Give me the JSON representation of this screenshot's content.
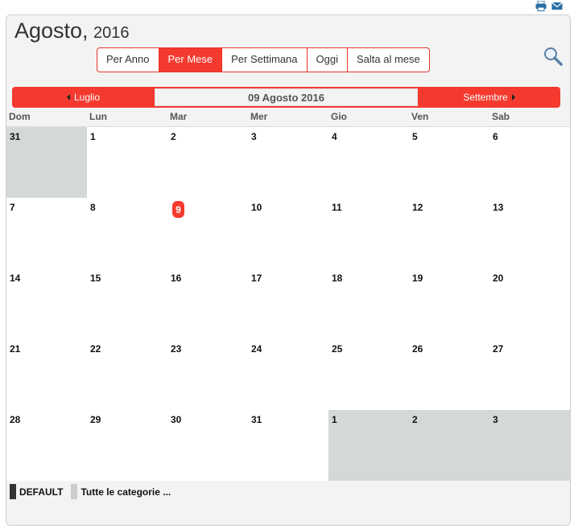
{
  "header": {
    "month": "Agosto,",
    "year": "2016"
  },
  "icons": {
    "print": "print-icon",
    "email": "email-icon",
    "search": "search-icon"
  },
  "view_buttons": [
    {
      "label": "Per Anno",
      "active": false
    },
    {
      "label": "Per Mese",
      "active": true
    },
    {
      "label": "Per Settimana",
      "active": false
    },
    {
      "label": "Oggi",
      "active": false
    },
    {
      "label": "Salta al mese",
      "active": false
    }
  ],
  "month_nav": {
    "prev": "Luglio",
    "current": "09 Agosto 2016",
    "next": "Settembre"
  },
  "weekdays": [
    "Dom",
    "Lun",
    "Mar",
    "Mer",
    "Gio",
    "Ven",
    "Sab"
  ],
  "weeks": [
    [
      {
        "day": "31",
        "other": true
      },
      {
        "day": "1"
      },
      {
        "day": "2"
      },
      {
        "day": "3"
      },
      {
        "day": "4"
      },
      {
        "day": "5"
      },
      {
        "day": "6"
      }
    ],
    [
      {
        "day": "7"
      },
      {
        "day": "8"
      },
      {
        "day": "9",
        "today": true
      },
      {
        "day": "10"
      },
      {
        "day": "11"
      },
      {
        "day": "12"
      },
      {
        "day": "13"
      }
    ],
    [
      {
        "day": "14"
      },
      {
        "day": "15"
      },
      {
        "day": "16"
      },
      {
        "day": "17"
      },
      {
        "day": "18"
      },
      {
        "day": "19"
      },
      {
        "day": "20"
      }
    ],
    [
      {
        "day": "21"
      },
      {
        "day": "22"
      },
      {
        "day": "23"
      },
      {
        "day": "24"
      },
      {
        "day": "25"
      },
      {
        "day": "26"
      },
      {
        "day": "27"
      }
    ],
    [
      {
        "day": "28"
      },
      {
        "day": "29"
      },
      {
        "day": "30"
      },
      {
        "day": "31"
      },
      {
        "day": "1",
        "other": true
      },
      {
        "day": "2",
        "other": true
      },
      {
        "day": "3",
        "other": true
      }
    ]
  ],
  "legend": [
    {
      "label": "DEFAULT",
      "color": "#333333"
    },
    {
      "label": "Tutte le categorie ...",
      "color": "#cccccc"
    }
  ],
  "colors": {
    "accent": "#f43a2f",
    "other_month": "#d5d8d8"
  }
}
